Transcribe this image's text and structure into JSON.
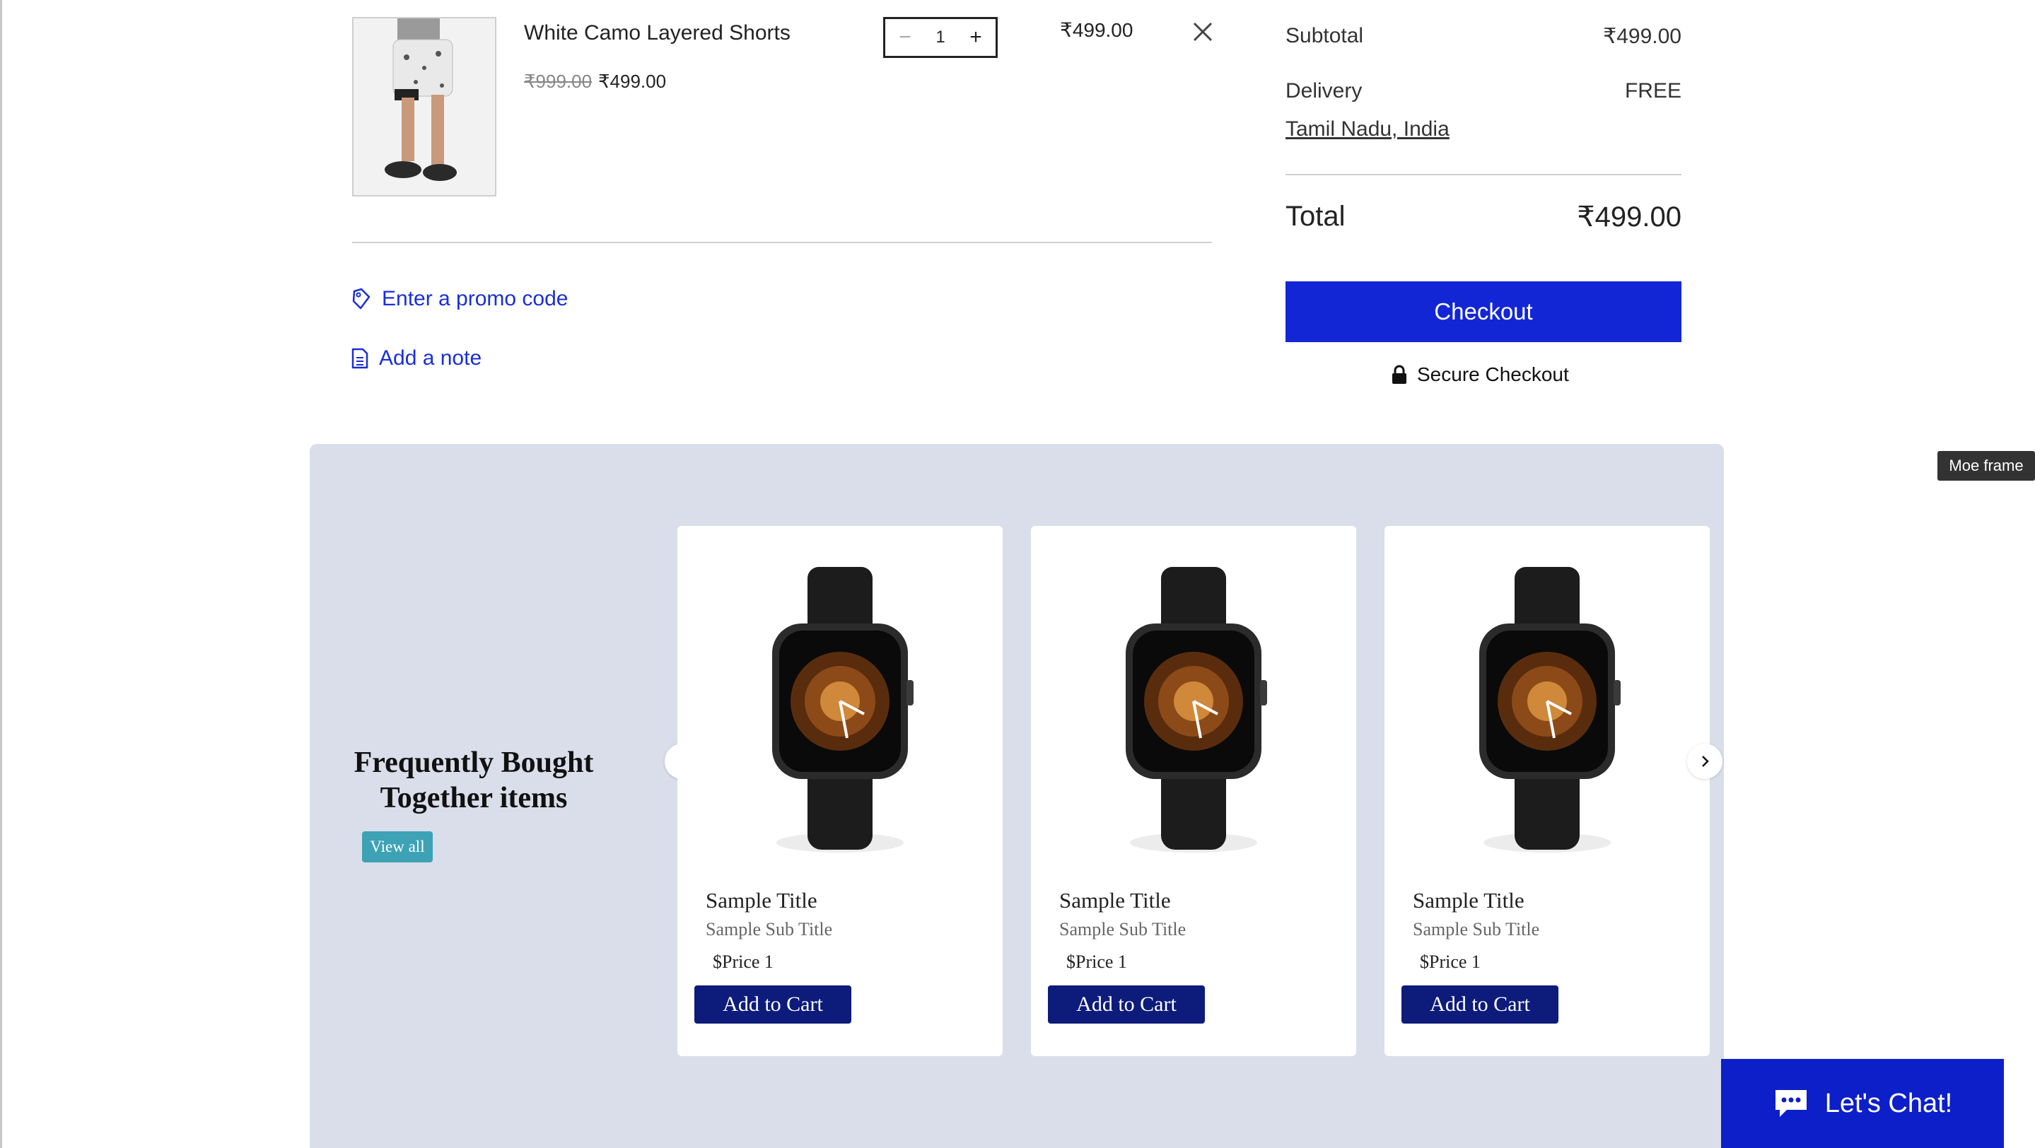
{
  "cart_item": {
    "name": "White Camo Layered Shorts",
    "original_price": "₹999.00",
    "sale_price": "₹499.00",
    "quantity": "1",
    "line_total": "₹499.00",
    "minus_symbol": "−",
    "plus_symbol": "+"
  },
  "actions": {
    "promo_label": "Enter a promo code",
    "note_label": "Add a note"
  },
  "summary": {
    "subtotal_label": "Subtotal",
    "subtotal_value": "₹499.00",
    "delivery_label": "Delivery",
    "delivery_value": "FREE",
    "location": "Tamil Nadu, India",
    "total_label": "Total",
    "total_value": "₹499.00",
    "checkout_label": "Checkout",
    "secure_label": "Secure Checkout"
  },
  "recommendations": {
    "title": "Frequently Bought Together items",
    "view_all": "View all",
    "products": [
      {
        "title": "Sample Title",
        "subtitle": "Sample Sub Title",
        "price": "$Price 1",
        "button": "Add to Cart"
      },
      {
        "title": "Sample Title",
        "subtitle": "Sample Sub Title",
        "price": "$Price 1",
        "button": "Add to Cart"
      },
      {
        "title": "Sample Title",
        "subtitle": "Sample Sub Title",
        "price": "$Price 1",
        "button": "Add to Cart"
      }
    ]
  },
  "tooltip": "Moe frame",
  "chat": {
    "label": "Let's Chat!"
  },
  "colors": {
    "accent_blue": "#1226d6",
    "link_blue": "#1a2fd6",
    "section_bg": "#d9deea",
    "add_to_cart_bg": "#0d1b7a",
    "view_all_bg": "#3ea2b6",
    "chat_bg": "#0d1fc9"
  },
  "icons": [
    "close-icon",
    "tag-icon",
    "note-icon",
    "lock-icon",
    "chevron-left-icon",
    "chevron-right-icon",
    "chat-bubble-icon"
  ]
}
